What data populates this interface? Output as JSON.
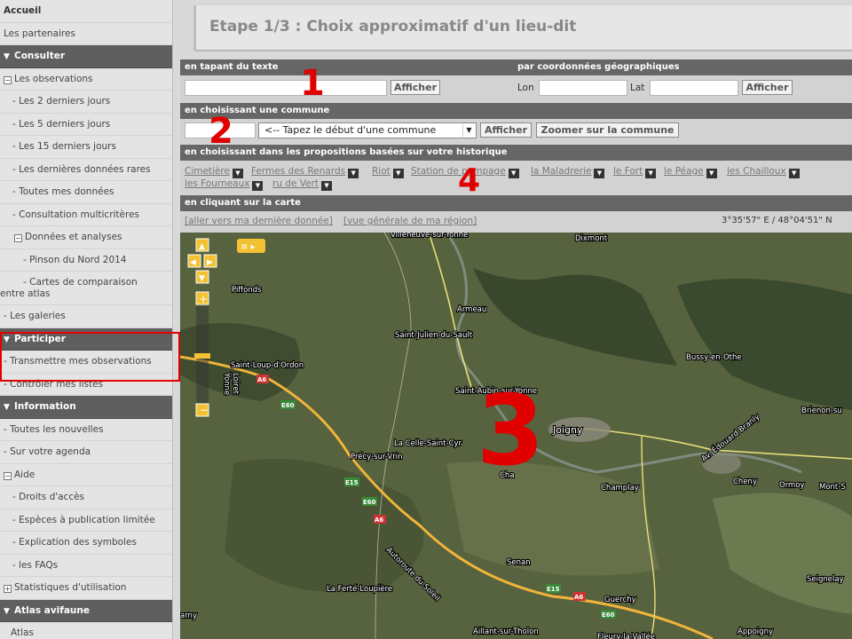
{
  "sidebar": {
    "accueil": "Accueil",
    "partenaires": "Les partenaires",
    "consulter": "Consulter",
    "observations": "Les observations",
    "d2": "- Les 2 derniers jours",
    "d5": "- Les 5 derniers jours",
    "d15": "- Les 15 derniers jours",
    "rares": "- Les dernières données rares",
    "toutes": "- Toutes mes données",
    "multi": "- Consultation multicritères",
    "analyses": "Données et analyses",
    "pinson": "- Pinson du Nord 2014",
    "cartes1": "- Cartes de comparaison",
    "cartes2": "entre atlas",
    "galeries": "- Les galeries",
    "participer": "Participer",
    "transmettre": "- Transmettre mes observations",
    "controler": "- Contrôler mes listes",
    "information": "Information",
    "nouvelles": "- Toutes les nouvelles",
    "agenda": "- Sur votre agenda",
    "aide": "Aide",
    "droits": "- Droits d'accès",
    "especes": "- Espèces à publication limitée",
    "symboles": "- Explication des symboles",
    "faqs": "- les FAQs",
    "stats": "Statistiques d'utilisation",
    "atlas": "Atlas avifaune",
    "atlas2": "Atlas"
  },
  "main": {
    "title": "Etape 1/3 : Choix approximatif d'un lieu-dit",
    "texte_header": "en tapant du texte",
    "coord_header": "par coordonnées géographiques",
    "afficher": "Afficher",
    "lon": "Lon",
    "lat": "Lat",
    "commune_header": "en choisissant une commune",
    "commune_placeholder": "<-- Tapez le début d'une commune",
    "zoomer": "Zoomer sur la commune",
    "hist_header": "en choisissant dans les propositions basées sur votre historique",
    "hist": [
      "Cimetière",
      "Fermes des Renards",
      "Riot",
      "Station de pompage",
      "la Maladrerie",
      "le Fort",
      "le Péage",
      "les Chailloux",
      "les Fourneaux",
      "ru de Vert"
    ],
    "carte_header": "en cliquant sur la carte",
    "link1": "[aller vers ma dernière donnée]",
    "link2": "[vue générale de ma région]",
    "coords": "3°35'57\" E / 48°04'51\" N"
  },
  "annotations": {
    "n1": "1",
    "n2": "2",
    "n3": "3",
    "n4": "4"
  },
  "map": {
    "places": [
      "Villeneuve-sur-Yonne",
      "Dixmont",
      "Piffonds",
      "Armeau",
      "Saint-Julien-du-Sault",
      "Bussy-en-Othe",
      "Saint-Loup-d'Ordon",
      "Saint-Aubin-sur-Yonne",
      "Brienon-su",
      "Joigny",
      "La Celle-Saint-Cyr",
      "Précy-sur-Vrin",
      "Champlay",
      "Cheny",
      "Ormoy",
      "Mont-S",
      "Senan",
      "Seignelay",
      "La Ferté-Loupière",
      "Guerchy",
      "Aillant-sur-Tholon",
      "Appoigny",
      "Yonne",
      "Loiret",
      "Autoroute du Soleil",
      "Av. Édouard Branly",
      "Cha",
      "arny",
      "Fleury-la-Vallée"
    ],
    "roads": [
      "A6",
      "E60",
      "E15",
      "E60",
      "A6",
      "E15",
      "A6",
      "E60"
    ]
  }
}
